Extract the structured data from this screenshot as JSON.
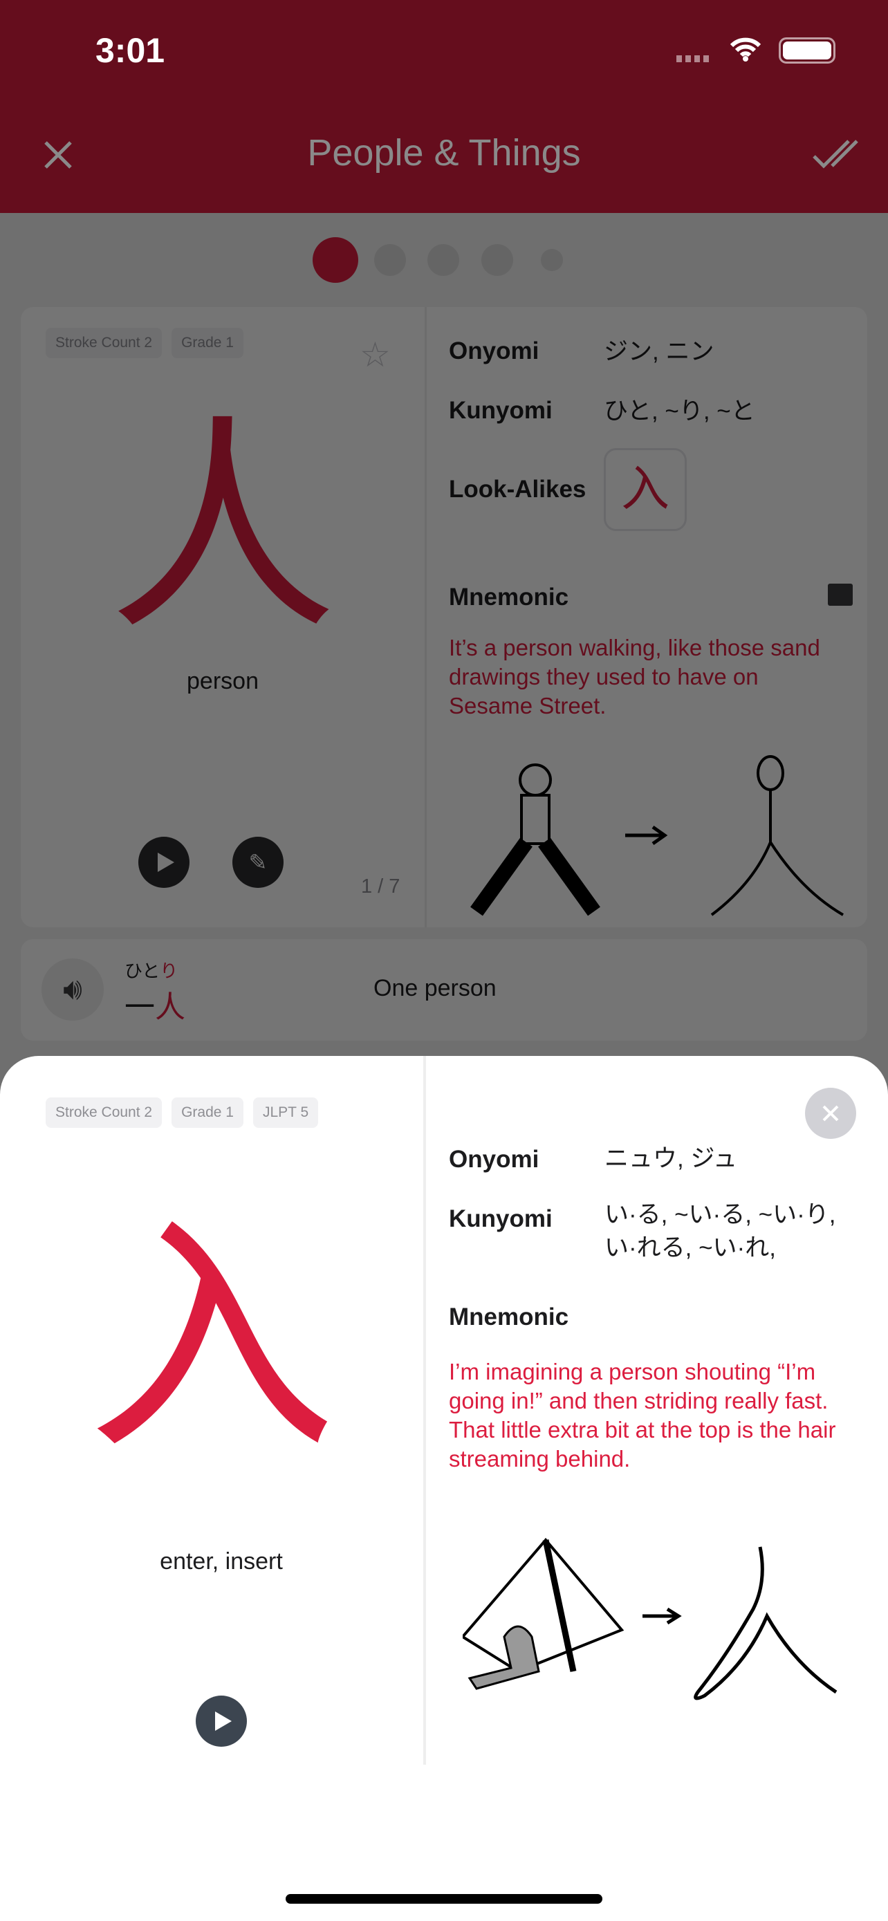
{
  "status_bar": {
    "time": "3:01"
  },
  "header": {
    "title": "People & Things",
    "close_icon": "close-icon",
    "done_icon": "double-check-icon"
  },
  "pager": {
    "count": 5,
    "active_index": 0
  },
  "main_card": {
    "chips": [
      "Stroke Count 2",
      "Grade 1"
    ],
    "kanji": "人",
    "meaning": "person",
    "counter": "1 / 7",
    "onyomi_label": "Onyomi",
    "onyomi": "ジン, ニン",
    "kunyomi_label": "Kunyomi",
    "kunyomi": "ひと, ~り, ~と",
    "lookalikes_label": "Look-Alikes",
    "lookalike": "入",
    "mnemonic_label": "Mnemonic",
    "mnemonic": "It’s a person walking, like those sand drawings they used to have on Sesame Street."
  },
  "example": {
    "reading_plain": "ひと",
    "reading_highlight": "り",
    "word_plain": "一",
    "word_highlight": "人",
    "translation": "One person"
  },
  "sheet": {
    "chips": [
      "Stroke Count 2",
      "Grade 1",
      "JLPT 5"
    ],
    "kanji": "入",
    "meaning": "enter, insert",
    "onyomi_label": "Onyomi",
    "onyomi": "ニュウ, ジュ",
    "kunyomi_label": "Kunyomi",
    "kunyomi": "い·る, ~い·る, ~い·り, い·れる, ~い·れ,",
    "mnemonic_label": "Mnemonic",
    "mnemonic": "I’m imagining a person shouting “I’m going in!” and then striding really fast. That little extra bit at the top is the hair streaming behind."
  },
  "colors": {
    "accent": "#dc1d3f",
    "overlay": "rgba(0,0,0,0.54)"
  }
}
